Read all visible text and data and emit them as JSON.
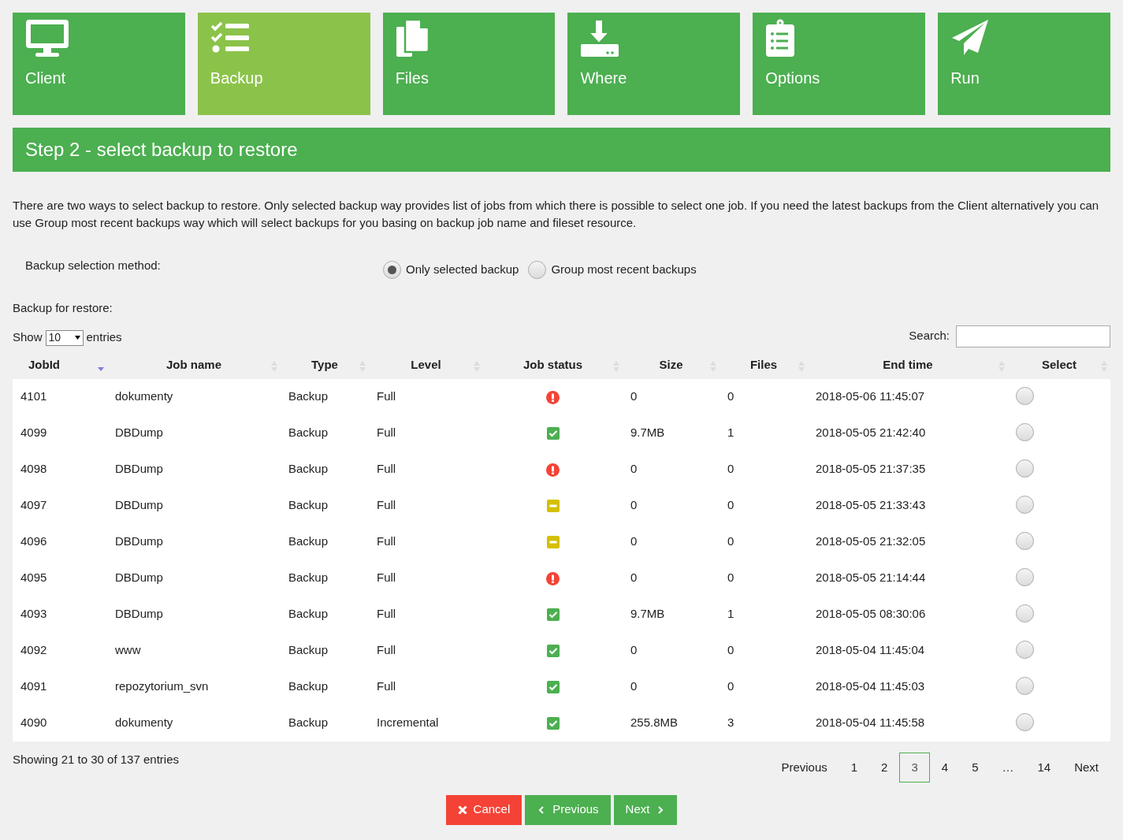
{
  "steps": [
    {
      "label": "Client",
      "kind": "monitor",
      "selected": false
    },
    {
      "label": "Backup",
      "kind": "checklist",
      "selected": true
    },
    {
      "label": "Files",
      "kind": "files",
      "selected": false
    },
    {
      "label": "Where",
      "kind": "download",
      "selected": false
    },
    {
      "label": "Options",
      "kind": "clipboard",
      "selected": false
    },
    {
      "label": "Run",
      "kind": "plane",
      "selected": false
    }
  ],
  "step_title": "Step 2 - select backup to restore",
  "description": "There are two ways to select backup to restore. Only selected backup way provides list of jobs from which there is possible to select one job. If you need the latest backups from the Client alternatively you can use Group most recent backups way which will select backups for you basing on backup job name and fileset resource.",
  "method": {
    "label": "Backup selection method:",
    "options": [
      {
        "label": "Only selected backup",
        "selected": true
      },
      {
        "label": "Group most recent backups",
        "selected": false
      }
    ]
  },
  "backup_label": "Backup for restore:",
  "length": {
    "prefix": "Show",
    "value": "10",
    "suffix": "entries"
  },
  "search": {
    "label": "Search:"
  },
  "table": {
    "columns": [
      {
        "label": "JobId",
        "sorted": true
      },
      {
        "label": "Job name",
        "sorted": false
      },
      {
        "label": "Type",
        "sorted": false
      },
      {
        "label": "Level",
        "sorted": false
      },
      {
        "label": "Job status",
        "sorted": false
      },
      {
        "label": "Size",
        "sorted": false
      },
      {
        "label": "Files",
        "sorted": false
      },
      {
        "label": "End time",
        "sorted": false
      },
      {
        "label": "Select",
        "sorted": false
      }
    ],
    "rows": [
      {
        "jobid": "4101",
        "name": "dokumenty",
        "type": "Backup",
        "level": "Full",
        "kind": "error",
        "size": "0",
        "files": "0",
        "end": "2018-05-06 11:45:07",
        "selected": false
      },
      {
        "jobid": "4099",
        "name": "DBDump",
        "type": "Backup",
        "level": "Full",
        "kind": "ok",
        "size": "9.7MB",
        "files": "1",
        "end": "2018-05-05 21:42:40",
        "selected": false
      },
      {
        "jobid": "4098",
        "name": "DBDump",
        "type": "Backup",
        "level": "Full",
        "kind": "error",
        "size": "0",
        "files": "0",
        "end": "2018-05-05 21:37:35",
        "selected": false
      },
      {
        "jobid": "4097",
        "name": "DBDump",
        "type": "Backup",
        "level": "Full",
        "kind": "warning",
        "size": "0",
        "files": "0",
        "end": "2018-05-05 21:33:43",
        "selected": false
      },
      {
        "jobid": "4096",
        "name": "DBDump",
        "type": "Backup",
        "level": "Full",
        "kind": "warning",
        "size": "0",
        "files": "0",
        "end": "2018-05-05 21:32:05",
        "selected": false
      },
      {
        "jobid": "4095",
        "name": "DBDump",
        "type": "Backup",
        "level": "Full",
        "kind": "error",
        "size": "0",
        "files": "0",
        "end": "2018-05-05 21:14:44",
        "selected": false
      },
      {
        "jobid": "4093",
        "name": "DBDump",
        "type": "Backup",
        "level": "Full",
        "kind": "ok",
        "size": "9.7MB",
        "files": "1",
        "end": "2018-05-05 08:30:06",
        "selected": false
      },
      {
        "jobid": "4092",
        "name": "www",
        "type": "Backup",
        "level": "Full",
        "kind": "ok",
        "size": "0",
        "files": "0",
        "end": "2018-05-04 11:45:04",
        "selected": false
      },
      {
        "jobid": "4091",
        "name": "repozytorium_svn",
        "type": "Backup",
        "level": "Full",
        "kind": "ok",
        "size": "0",
        "files": "0",
        "end": "2018-05-04 11:45:03",
        "selected": false
      },
      {
        "jobid": "4090",
        "name": "dokumenty",
        "type": "Backup",
        "level": "Incremental",
        "kind": "ok",
        "size": "255.8MB",
        "files": "3",
        "end": "2018-05-04 11:45:58",
        "selected": false
      }
    ]
  },
  "info": "Showing 21 to 30 of 137 entries",
  "pagination": [
    {
      "label": "Previous",
      "selected": false
    },
    {
      "label": "1",
      "selected": false
    },
    {
      "label": "2",
      "selected": false
    },
    {
      "label": "3",
      "selected": true
    },
    {
      "label": "4",
      "selected": false
    },
    {
      "label": "5",
      "selected": false
    },
    {
      "label": "…",
      "selected": false
    },
    {
      "label": "14",
      "selected": false
    },
    {
      "label": "Next",
      "selected": false
    }
  ],
  "buttons": [
    {
      "label": "Cancel",
      "kind": "cancel"
    },
    {
      "label": "Previous",
      "kind": "previous"
    },
    {
      "label": "Next",
      "kind": "next"
    }
  ]
}
